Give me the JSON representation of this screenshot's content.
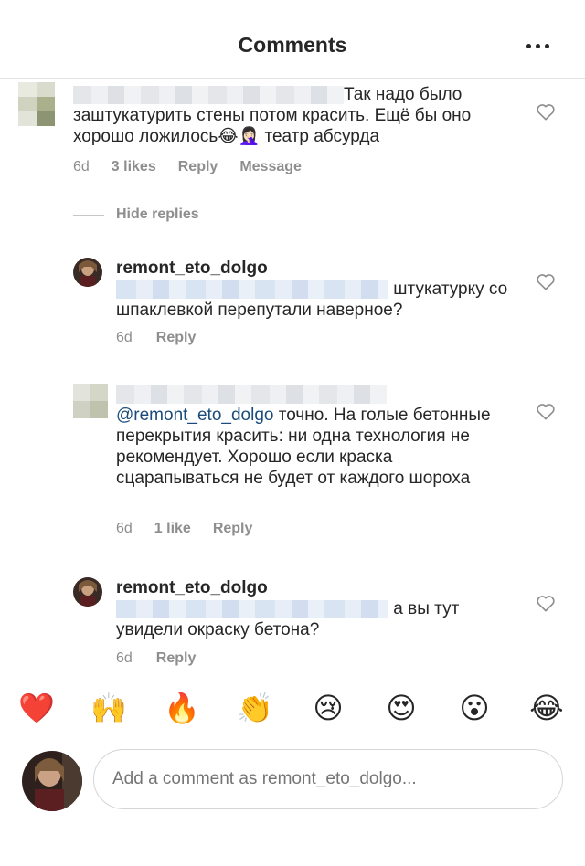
{
  "header": {
    "title": "Comments"
  },
  "comments": [
    {
      "text": "Так надо было заштукатурить стены потом красить. Ещё бы оно хорошо ложилось",
      "text_tail": " театр абсурда",
      "emoji1": "😂",
      "emoji2": "🤦🏻‍♀️",
      "age": "6d",
      "likes": "3 likes",
      "reply": "Reply",
      "message": "Message"
    }
  ],
  "hide_replies": "Hide replies",
  "replies": [
    {
      "username": "remont_eto_dolgo",
      "text": "штукатурку со шпаклевкой перепутали наверное?",
      "age": "6d",
      "reply": "Reply"
    },
    {
      "mention": "@remont_eto_dolgo",
      "text": " точно. На голые бетонные перекрытия красить: ни одна технология не рекомендует. Хорошо если краска сцарапываться не будет от каждого шороха",
      "age": "6d",
      "likes": "1 like",
      "reply": "Reply"
    },
    {
      "username": "remont_eto_dolgo",
      "text": "а вы тут увидели окраску бетона?",
      "age": "6d",
      "reply": "Reply"
    }
  ],
  "emoji_bar": [
    "❤️",
    "🙌",
    "🔥",
    "👏",
    "😢",
    "😍",
    "😮",
    "😂"
  ],
  "composer": {
    "placeholder": "Add a comment as remont_eto_dolgo..."
  }
}
